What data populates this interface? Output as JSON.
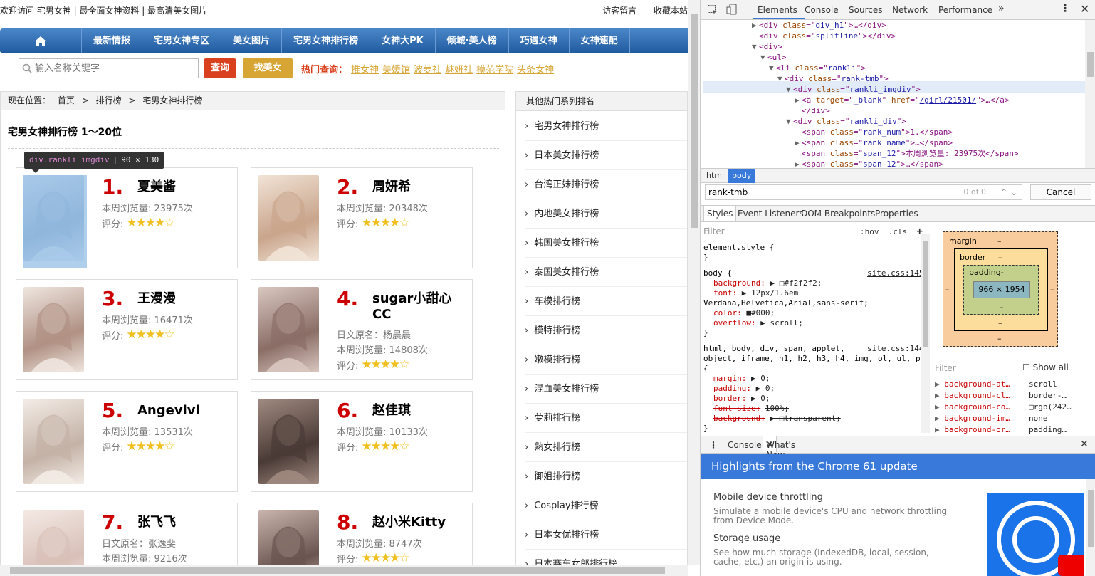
{
  "topbar": {
    "welcome": "欢迎访问 宅男女神 | 最全面女神资料 | 最高清美女图片",
    "links": [
      "访客留言",
      "收藏本站"
    ]
  },
  "nav": {
    "items": [
      "最新情报",
      "宅男女神专区",
      "美女图片",
      "宅男女神排行榜",
      "女神大PK",
      "倾城·美人榜",
      "巧遇女神",
      "女神速配"
    ]
  },
  "search": {
    "placeholder": "输入名称关键字",
    "query_button": "查询",
    "find_button": "找美女",
    "hot_label": "热门查询：",
    "hot_links": [
      "推女神",
      "美媛馆",
      "波萝社",
      "魅妍社",
      "模范学院",
      "头条女神"
    ]
  },
  "breadcrumb": {
    "prefix": "现在位置：",
    "items": [
      "首页",
      "排行榜",
      "宅男女神排行榜"
    ],
    "sep": ">"
  },
  "ranking": {
    "title": "宅男女神排行榜 1～20位",
    "views_label": "本周浏览量:",
    "score_label": "评分:",
    "cards": [
      {
        "rank": "1.",
        "name": "夏美酱",
        "alias": "",
        "views": "23975次",
        "stars": "★★★★☆"
      },
      {
        "rank": "2.",
        "name": "周妍希",
        "alias": "",
        "views": "20348次",
        "stars": "★★★★☆"
      },
      {
        "rank": "3.",
        "name": "王漫漫",
        "alias": "",
        "views": "16471次",
        "stars": "★★★★☆"
      },
      {
        "rank": "4.",
        "name": "sugar小甜心CC",
        "alias": "日文原名：杨晨晨",
        "views": "14808次",
        "stars": "★★★★☆"
      },
      {
        "rank": "5.",
        "name": "Angevivi",
        "alias": "",
        "views": "13531次",
        "stars": "★★★★☆"
      },
      {
        "rank": "6.",
        "name": "赵佳琪",
        "alias": "",
        "views": "10133次",
        "stars": "★★★★☆"
      },
      {
        "rank": "7.",
        "name": "张飞飞",
        "alias": "日文原名：张逸斐",
        "views": "9216次",
        "stars": "★★★★☆"
      },
      {
        "rank": "8.",
        "name": "赵小米Kitty",
        "alias": "",
        "views": "8747次",
        "stars": "★★★★☆"
      }
    ]
  },
  "inspector_tooltip": {
    "selector": "div.rankli_imgdiv",
    "size": "90 × 130"
  },
  "sidebar": {
    "title": "其他热门系列排名",
    "items": [
      "宅男女神排行榜",
      "日本美女排行榜",
      "台湾正妹排行榜",
      "内地美女排行榜",
      "韩国美女排行榜",
      "泰国美女排行榜",
      "车模排行榜",
      "模特排行榜",
      "嫩模排行榜",
      "混血美女排行榜",
      "萝莉排行榜",
      "熟女排行榜",
      "御姐排行榜",
      "Cosplay排行榜",
      "日本女优排行榜",
      "日本赛车女郎排行榜"
    ]
  },
  "devtools": {
    "tabs": [
      "Elements",
      "Console",
      "Sources",
      "Network",
      "Performance"
    ],
    "dom_lines": [
      {
        "indent": 6,
        "arrow": "▶",
        "html": "<div class=\"div_h1\">…</div>"
      },
      {
        "indent": 6,
        "arrow": "",
        "html": "<div class=\"splitline\"></div>"
      },
      {
        "indent": 6,
        "arrow": "▼",
        "html": "<div>"
      },
      {
        "indent": 7,
        "arrow": "▼",
        "html": "<ul>"
      },
      {
        "indent": 8,
        "arrow": "▼",
        "html": "<li class=\"rankli\">"
      },
      {
        "indent": 9,
        "arrow": "▼",
        "html": "<div class=\"rank-tmb\">"
      },
      {
        "indent": 10,
        "arrow": "▼",
        "html": "<div class=\"rankli_imgdiv\">"
      },
      {
        "indent": 11,
        "arrow": "▶",
        "html": "<a target=\"_blank\" href=\"/girl/21501/\">…</a>"
      },
      {
        "indent": 11,
        "arrow": "",
        "html": "</div>"
      },
      {
        "indent": 10,
        "arrow": "▼",
        "html": "<div class=\"rankli_div\">"
      },
      {
        "indent": 11,
        "arrow": "",
        "html": "<span class=\"rank_num\">1.</span>"
      },
      {
        "indent": 11,
        "arrow": "▶",
        "html": "<span class=\"rank_name\">…</span>"
      },
      {
        "indent": 11,
        "arrow": "",
        "html": "<span class=\"span_12\">本周浏览量: 23975次</span>"
      },
      {
        "indent": 11,
        "arrow": "▶",
        "html": "<span class=\"span_12\">…</span>"
      }
    ],
    "crumbs": [
      "html",
      "body"
    ],
    "search_value": "rank-tmb",
    "search_count": "0 of 0",
    "cancel": "Cancel",
    "subtabs": [
      "Styles",
      "Event Listeners",
      "DOM Breakpoints",
      "Properties"
    ],
    "styles_filter": "Filter",
    "hov": ":hov",
    "cls": ".cls",
    "style_lines": [
      {
        "t": "element.style {"
      },
      {
        "t": "}"
      },
      {
        "t": "body {",
        "src": "site.css:1457"
      },
      {
        "p": "background:",
        "v": "▶ □#f2f2f2;"
      },
      {
        "p": "font:",
        "v": "▶ 12px/1.6em"
      },
      {
        "t": "    Verdana,Helvetica,Arial,sans-serif;"
      },
      {
        "p": "color:",
        "v": "■#000;"
      },
      {
        "p": "overflow:",
        "v": "▶ scroll;"
      },
      {
        "t": "}"
      },
      {
        "t": "html, body, div, span, applet,",
        "src": "site.css:1447"
      },
      {
        "t": "object, iframe, h1, h2, h3, h4, img, ol, ul, p"
      },
      {
        "t": "{"
      },
      {
        "p": "margin:",
        "v": "▶ 0;"
      },
      {
        "p": "padding:",
        "v": "▶ 0;"
      },
      {
        "p": "border:",
        "v": "▶ 0;"
      },
      {
        "p": "font-size:",
        "v": "100%;",
        "strike": true
      },
      {
        "p": "background:",
        "v": "▶ □transparent;",
        "strike": true
      },
      {
        "t": "}"
      }
    ],
    "boxmodel": {
      "margin": "margin",
      "border": "border",
      "padding": "padding-",
      "content": "966 × 1954",
      "dash": "–"
    },
    "computed_filter": "Filter",
    "show_all": "Show all",
    "computed": [
      {
        "p": "background-at…",
        "v": "scroll"
      },
      {
        "p": "background-cl…",
        "v": "border-…"
      },
      {
        "p": "background-co…",
        "v": "□rgb(242…"
      },
      {
        "p": "background-im…",
        "v": "none"
      },
      {
        "p": "background-or…",
        "v": "padding…"
      }
    ],
    "drawer_tabs": [
      "Console",
      "What's New"
    ],
    "whatsnew_title": "Highlights from the Chrome 61 update",
    "whatsnew_items": [
      {
        "title": "Mobile device throttling",
        "desc": "Simulate a mobile device's CPU and network throttling from Device Mode."
      },
      {
        "title": "Storage usage",
        "desc": "See how much storage (IndexedDB, local, session, cache, etc.) an origin is using."
      }
    ]
  }
}
